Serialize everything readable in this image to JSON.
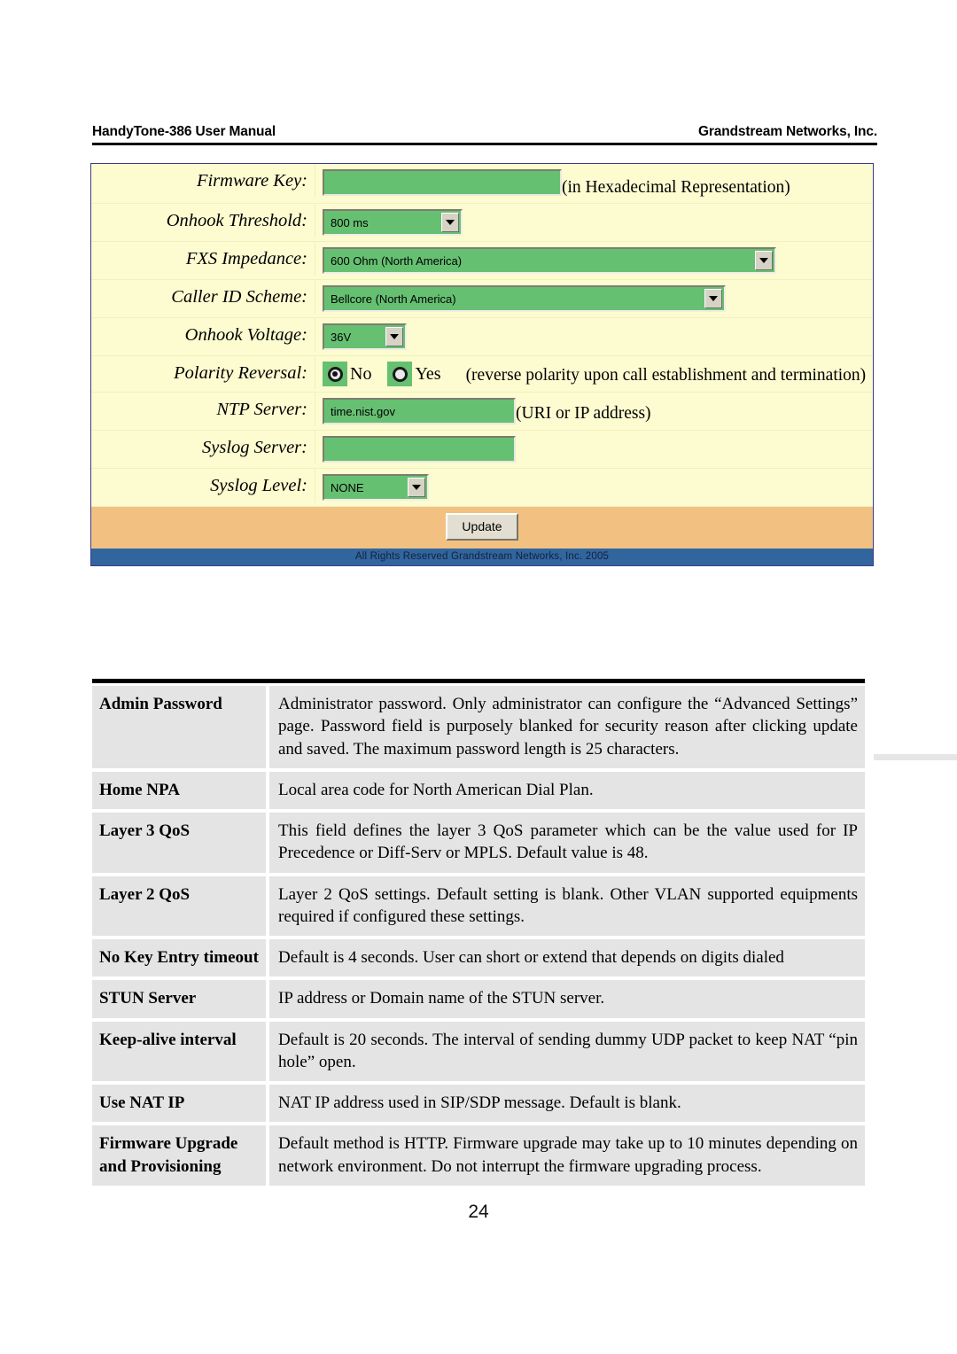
{
  "header": {
    "left_title": "HandyTone-386 User Manual",
    "right_title": "Grandstream Networks, Inc."
  },
  "config_panel": {
    "rows": [
      {
        "label": "Firmware Key:",
        "control": "text",
        "value": "",
        "hint": "(in Hexadecimal Representation)"
      },
      {
        "label": "Onhook Threshold:",
        "control": "select",
        "value": "800 ms",
        "hint": ""
      },
      {
        "label": "FXS Impedance:",
        "control": "select",
        "value": "600 Ohm (North America)",
        "hint": ""
      },
      {
        "label": "Caller ID Scheme:",
        "control": "select",
        "value": "Bellcore (North America)",
        "hint": ""
      },
      {
        "label": "Onhook Voltage:",
        "control": "select",
        "value": "36V",
        "hint": ""
      },
      {
        "label": "Polarity Reversal:",
        "control": "radio",
        "options": [
          {
            "label": "No",
            "checked": true
          },
          {
            "label": "Yes",
            "checked": false
          }
        ],
        "hint": "(reverse polarity upon call establishment and termination)"
      },
      {
        "label": "NTP Server:",
        "control": "text",
        "value": "time.nist.gov",
        "hint": "(URI or IP address)"
      },
      {
        "label": "Syslog Server:",
        "control": "text",
        "value": "",
        "hint": ""
      },
      {
        "label": "Syslog Level:",
        "control": "select",
        "value": "NONE",
        "hint": ""
      }
    ],
    "update_label": "Update",
    "footer_text": "All Rights Reserved Grandstream Networks, Inc. 2005",
    "colors": {
      "panel_background": "#fdfbd0",
      "field_green": "#66c072",
      "update_band": "#f2c181",
      "footer_blue": "#31659e",
      "panel_border": "#3b3b8f"
    }
  },
  "description_table": {
    "rows": [
      {
        "term": "Admin Password",
        "definition": "Administrator password. Only administrator can configure the “Advanced Settings” page. Password field is purposely blanked for security reason after clicking update and saved. The maximum password length is 25 characters."
      },
      {
        "term": "Home NPA",
        "definition": "Local area code for North American Dial Plan."
      },
      {
        "term": "Layer 3 QoS",
        "definition": "This field defines the layer 3 QoS parameter which can be the value used for IP Precedence or Diff-Serv or MPLS. Default value is 48."
      },
      {
        "term": "Layer 2 QoS",
        "definition": "Layer 2 QoS settings. Default setting is blank. Other VLAN supported equipments required if configured these settings."
      },
      {
        "term": "No Key Entry timeout",
        "definition": "Default is 4 seconds.  User can short or extend that depends on digits dialed"
      },
      {
        "term": "STUN Server",
        "definition": "IP address or Domain name of the STUN server."
      },
      {
        "term": "Keep-alive interval",
        "definition": "Default is 20 seconds. The interval of sending dummy UDP packet to keep NAT “pin hole” open."
      },
      {
        "term": "Use NAT IP",
        "definition": "NAT IP address used in SIP/SDP message. Default is blank."
      },
      {
        "term": "Firmware Upgrade and Provisioning",
        "definition": "Default method is HTTP.  Firmware upgrade may take up to 10 minutes depending on network environment. Do not interrupt the firmware upgrading process."
      }
    ]
  },
  "page_number": "24"
}
